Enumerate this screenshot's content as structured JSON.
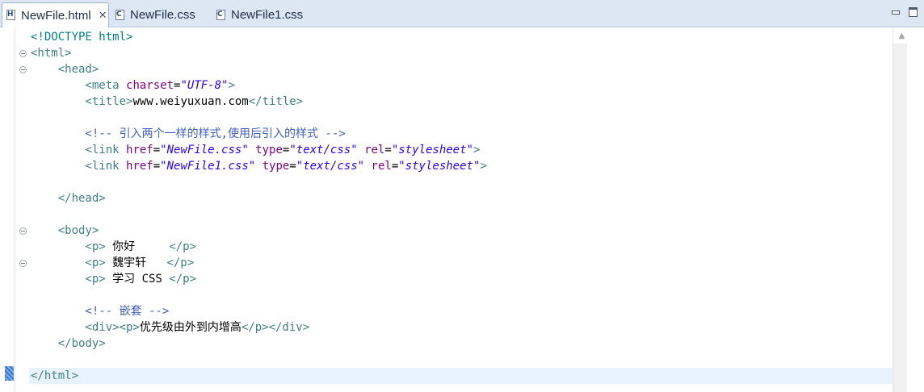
{
  "tabs": [
    {
      "label": "NewFile.html",
      "icon": "html-file-icon",
      "active": true,
      "closable": true
    },
    {
      "label": "NewFile.css",
      "icon": "css-file-icon",
      "active": false
    },
    {
      "label": "NewFile1.css",
      "icon": "css-file-icon",
      "active": false
    }
  ],
  "editor": {
    "current_line": 22,
    "lines": [
      [
        [
          "dt",
          "<!DOCTYPE html>"
        ]
      ],
      [
        [
          "tag",
          "<html>"
        ]
      ],
      [
        [
          "tag",
          "    <head>"
        ]
      ],
      [
        [
          "tag",
          "        <meta "
        ],
        [
          "att",
          "charset"
        ],
        [
          "txt",
          "="
        ],
        [
          "val",
          "\"UTF-8\""
        ],
        [
          "tag",
          ">"
        ]
      ],
      [
        [
          "tag",
          "        <title>"
        ],
        [
          "txt",
          "www.weiyuxuan.com"
        ],
        [
          "tag",
          "</title>"
        ]
      ],
      [],
      [
        [
          "cmt",
          "        <!-- 引入两个一样的样式,使用后引入的样式 -->"
        ]
      ],
      [
        [
          "tag",
          "        <link "
        ],
        [
          "att",
          "href"
        ],
        [
          "txt",
          "="
        ],
        [
          "val",
          "\"NewFile.css\""
        ],
        [
          "txt",
          " "
        ],
        [
          "att",
          "type"
        ],
        [
          "txt",
          "="
        ],
        [
          "val",
          "\"text/css\""
        ],
        [
          "txt",
          " "
        ],
        [
          "att",
          "rel"
        ],
        [
          "txt",
          "="
        ],
        [
          "val",
          "\"stylesheet\""
        ],
        [
          "tag",
          ">"
        ]
      ],
      [
        [
          "tag",
          "        <link "
        ],
        [
          "att",
          "href"
        ],
        [
          "txt",
          "="
        ],
        [
          "val",
          "\"NewFile1.css\""
        ],
        [
          "txt",
          " "
        ],
        [
          "att",
          "type"
        ],
        [
          "txt",
          "="
        ],
        [
          "val",
          "\"text/css\""
        ],
        [
          "txt",
          " "
        ],
        [
          "att",
          "rel"
        ],
        [
          "txt",
          "="
        ],
        [
          "val",
          "\"stylesheet\""
        ],
        [
          "tag",
          ">"
        ]
      ],
      [],
      [
        [
          "tag",
          "    </head>"
        ]
      ],
      [],
      [
        [
          "tag",
          "    <body>"
        ]
      ],
      [
        [
          "tag",
          "        <p>"
        ],
        [
          "txt",
          " 你好     "
        ],
        [
          "tag",
          "</p>"
        ]
      ],
      [
        [
          "tag",
          "        <p>"
        ],
        [
          "txt",
          " 魏宇轩   "
        ],
        [
          "tag",
          "</p>"
        ]
      ],
      [
        [
          "tag",
          "        <p>"
        ],
        [
          "txt",
          " 学习 CSS "
        ],
        [
          "tag",
          "</p>"
        ]
      ],
      [],
      [
        [
          "cmt",
          "        <!-- 嵌套 -->"
        ]
      ],
      [
        [
          "tag",
          "        <div><p>"
        ],
        [
          "txt",
          "优先级由外到内增高"
        ],
        [
          "tag",
          "</p></div>"
        ]
      ],
      [
        [
          "tag",
          "    </body>"
        ]
      ],
      [],
      [
        [
          "tag",
          "</html>"
        ]
      ]
    ],
    "fold_lines": [
      2,
      3,
      13,
      15
    ]
  }
}
